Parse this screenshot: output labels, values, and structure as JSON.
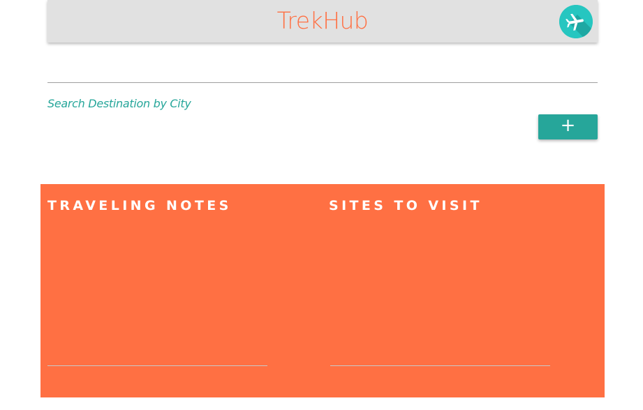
{
  "app": {
    "title": "TrekHub",
    "logo_icon": "airplane-icon",
    "brand_color": "#ff7043",
    "logo_color": "#26c6c0"
  },
  "search": {
    "value": "",
    "label": "Search Destination by City",
    "label_color": "#26a69a"
  },
  "add_button": {
    "label": "+",
    "color": "#26a69a"
  },
  "panel": {
    "color": "#ff7043",
    "columns": [
      {
        "title": "TRAVELING NOTES",
        "value": ""
      },
      {
        "title": "SITES TO VISIT",
        "value": ""
      }
    ]
  }
}
